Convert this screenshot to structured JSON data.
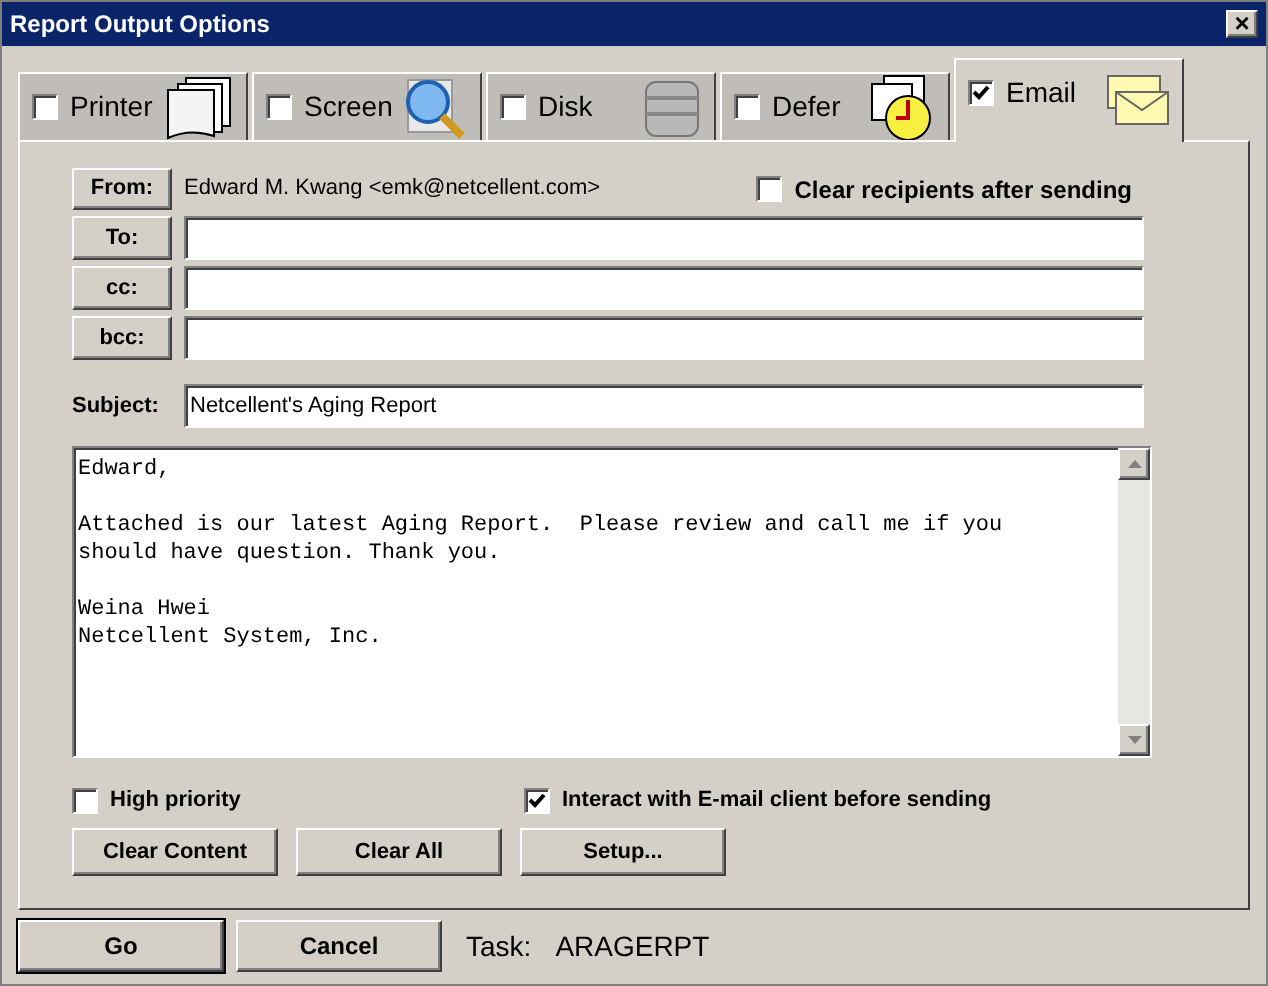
{
  "window": {
    "title": "Report Output Options",
    "close": "×"
  },
  "tabs": [
    {
      "label": "Printer",
      "kind": "printer",
      "checked": false,
      "selected": false
    },
    {
      "label": "Screen",
      "kind": "screen",
      "checked": false,
      "selected": false
    },
    {
      "label": "Disk",
      "kind": "disk",
      "checked": false,
      "selected": false
    },
    {
      "label": "Defer",
      "kind": "defer",
      "checked": false,
      "selected": false
    },
    {
      "label": "Email",
      "kind": "email",
      "checked": true,
      "selected": true
    }
  ],
  "from": {
    "button": "From:",
    "value": "Edward M. Kwang <emk@netcellent.com>"
  },
  "clear_recipients": {
    "label": "Clear recipients after sending",
    "checked": false
  },
  "recipients": [
    {
      "button": "To:"
    },
    {
      "button": "cc:"
    },
    {
      "button": "bcc:"
    }
  ],
  "subject": {
    "label": "Subject:",
    "value": "Netcellent's Aging Report"
  },
  "message": "Edward,\n\nAttached is our latest Aging Report.  Please review and call me if you\nshould have question. Thank you.\n\nWeina Hwei\nNetcellent System, Inc.",
  "options": [
    {
      "label": "High priority",
      "checked": false
    },
    {
      "label": "Interact with E-mail client before sending",
      "checked": true
    }
  ],
  "actions": [
    "Clear Content",
    "Clear All",
    "Setup..."
  ],
  "footer": {
    "buttons": [
      "Go",
      "Cancel"
    ],
    "task_label": "Task:",
    "task_value": "ARAGERPT"
  }
}
